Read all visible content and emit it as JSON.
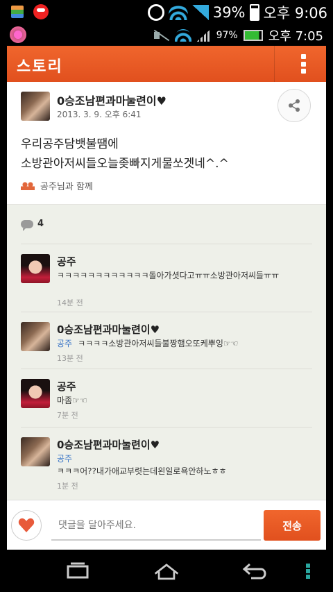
{
  "status_outer": {
    "battery": "39%",
    "time": "오후 9:06"
  },
  "status_inner": {
    "battery": "97%",
    "time": "오후 7:05"
  },
  "header": {
    "title": "스토리"
  },
  "post": {
    "author": "0승조남편과마눌련이♥",
    "date": "2013. 3. 9. 오후 6:41",
    "body": "우리공주담뱃불땜에\n소방관아저씨들오늘좆빠지게물쏘겟네^.^",
    "with_label": "공주님과 함께"
  },
  "comments_count": "4",
  "comments": [
    {
      "name": "공주",
      "mention": "",
      "text": "ㅋㅋㅋㅋㅋㅋㅋㅋㅋㅋㅋㅋ돌아가셧다고ㅠㅠ소방관아저씨들ㅠㅠ",
      "time": "14분 전"
    },
    {
      "name": "0승조남편과마눌련이♥",
      "mention": "공주",
      "text": "ㅋㅋㅋㅋ소방관아저씨들불짱햄오또케뿌잉☞☜",
      "time": "13분 전"
    },
    {
      "name": "공주",
      "mention": "",
      "text": "마좀☞☜",
      "time": "7분 전"
    },
    {
      "name": "0승조남편과마눌련이♥",
      "mention": "공주",
      "text": "ㅋㅋㅋ어??내가애교부렷는데왼일로욕안하노ㅎㅎ",
      "time": "1분 전"
    }
  ],
  "input": {
    "placeholder": "댓글을 달아주세요."
  },
  "send_label": "전송",
  "colors": {
    "accent": "#e85a25",
    "mention": "#3b76c7"
  }
}
